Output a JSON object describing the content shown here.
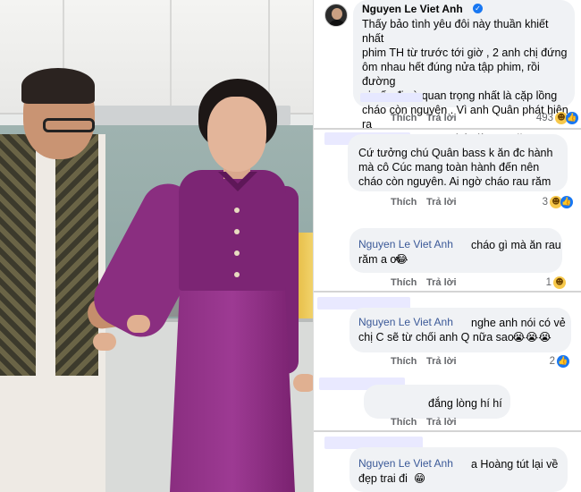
{
  "comments": [
    {
      "author": "Nguyen Le Viet Anh",
      "text": "Thấy bảo tình yêu đôi này thuần khiết nhất\nphim TH từ trước tới giờ ,  2 anh chị đứng\nôm nhau hết đúng nửa tập phim, rồi đường\nai nấy đi và quan trọng nhất là cặp lồng\ncháo còn nguyên . Vì anh Quân phát hiện ra\ntoàn bộ rau trong cháo là  rau Răm .",
      "like": "Thích",
      "reply": "Trả lời",
      "reactions": "493"
    },
    {
      "author": "",
      "text": "Cứ tưởng chú Quân bass k ăn đc hành\nmà cô Cúc mang toàn hành đến nên\ncháo còn nguyên. Ai ngờ cháo rau răm",
      "like": "Thích",
      "reply": "Trả lời",
      "reactions": "3"
    },
    {
      "author": "Nguyen Le Viet Anh",
      "text": "cháo gì mà ăn rau\nrăm a ơi",
      "emoji": "😂",
      "like": "Thích",
      "reply": "Trả lời",
      "reactions": "1"
    },
    {
      "author": "Nguyen Le Viet Anh",
      "text": "nghe anh nói có vẻ\nchị C sẽ từ chối anh Q nữa sao",
      "emoji": "😭😭😭",
      "like": "Thích",
      "reply": "Trả lời",
      "reactions": "2"
    },
    {
      "author": "",
      "text": "đắng lòng hí hí",
      "like": "Thích",
      "reply": "Trả lời",
      "reactions": ""
    },
    {
      "author": "Nguyen Le Viet Anh",
      "text": "a Hoàng tút lại về\nđẹp trai đi",
      "emoji": "😁"
    }
  ],
  "colors": {
    "bubble": "#f0f2f5",
    "name_link": "#3b5998",
    "meta": "#65676b",
    "like_blue": "#1877f2",
    "haha_yellow": "#f7c84a",
    "dress_purple": "#7c2574"
  },
  "icons": {
    "verified": "verified-badge-icon",
    "haha": "haha-reaction-icon",
    "like": "like-reaction-icon"
  }
}
